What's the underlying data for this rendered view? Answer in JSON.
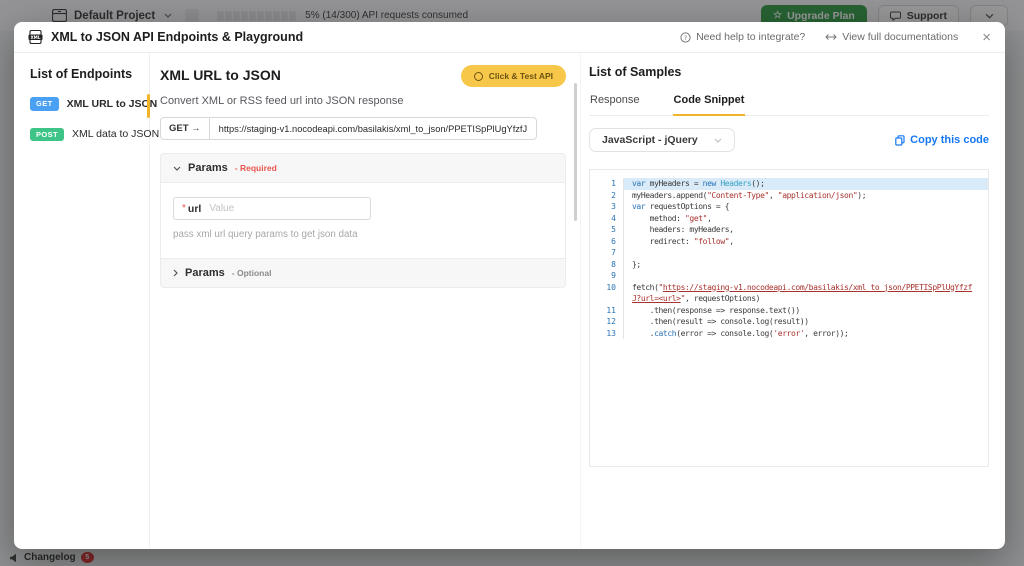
{
  "colors": {
    "accent": "#f0b429",
    "get": "#4aa0f2",
    "post": "#3fc487",
    "test_bg": "#f7c74a",
    "test_text": "#6d5414",
    "link": "#1778f2",
    "required": "#e6574d",
    "upgrade": "#2f9e44",
    "badge": "#e03131",
    "code_keyword": "#2973b7",
    "code_type": "#38a1c4",
    "code_string": "#a8322d",
    "num": "#2973b7",
    "hl": "#d9ebf8",
    "plain": "#3a3a3a"
  },
  "topbar": {
    "project": "Default Project",
    "segments": 10,
    "usage_text": "5% (14/300) API requests consumed",
    "upgrade_label": "Upgrade Plan",
    "upgrade_icon": "☆",
    "support_label": "Support"
  },
  "changelog": {
    "label": "Changelog",
    "count": "5"
  },
  "modal": {
    "title": "XML to JSON API Endpoints & Playground",
    "help_link": "Need help to integrate?",
    "docs_link": "View full documentations",
    "close_label": "×"
  },
  "sidebar": {
    "heading": "List of Endpoints",
    "items": [
      {
        "method": "GET",
        "label": "XML URL to JSON",
        "active": true
      },
      {
        "method": "POST",
        "label": "XML data to JSON",
        "active": false
      }
    ]
  },
  "endpoint": {
    "title": "XML URL to JSON",
    "test_button": "Click & Test API",
    "description": "Convert XML or RSS feed url into JSON response",
    "method_label": "GET →",
    "url": "https://staging-v1.nocodeapi.com/basilakis/xml_to_json/PPETISpPlUgYfzfJ",
    "params_required": {
      "title": "Params",
      "badge": "- Required",
      "field_label": "url",
      "asterisk": "*",
      "placeholder": "Value",
      "helper": "pass xml url query params to get json data"
    },
    "params_optional": {
      "title": "Params",
      "badge": "- Optional"
    }
  },
  "samples": {
    "heading": "List of Samples",
    "tabs": [
      "Response",
      "Code Snippet"
    ],
    "active_tab": "Code Snippet",
    "language": "JavaScript - jQuery",
    "copy_label": "Copy this code",
    "code": {
      "lines": [
        {
          "n": "1",
          "hl": true,
          "toks": [
            [
              "k",
              "var"
            ],
            [
              "p",
              " myHeaders = "
            ],
            [
              "k",
              "new"
            ],
            [
              "t",
              " Headers"
            ],
            [
              "p",
              "();"
            ]
          ]
        },
        {
          "n": "2",
          "toks": [
            [
              "p",
              "myHeaders.append("
            ],
            [
              "s",
              "\"Content-Type\""
            ],
            [
              "p",
              ", "
            ],
            [
              "s",
              "\"application/json\""
            ],
            [
              "p",
              ");"
            ]
          ]
        },
        {
          "n": "3",
          "toks": [
            [
              "k",
              "var"
            ],
            [
              "p",
              " requestOptions = {"
            ]
          ]
        },
        {
          "n": "4",
          "toks": [
            [
              "p",
              "    method: "
            ],
            [
              "s",
              "\"get\""
            ],
            [
              "p",
              ","
            ]
          ]
        },
        {
          "n": "5",
          "toks": [
            [
              "p",
              "    headers: myHeaders,"
            ]
          ]
        },
        {
          "n": "6",
          "toks": [
            [
              "p",
              "    redirect: "
            ],
            [
              "s",
              "\"follow\""
            ],
            [
              "p",
              ","
            ]
          ]
        },
        {
          "n": "7",
          "toks": []
        },
        {
          "n": "8",
          "toks": [
            [
              "p",
              "};"
            ]
          ]
        },
        {
          "n": "9",
          "toks": []
        },
        {
          "n": "10",
          "toks": [
            [
              "p",
              "fetch("
            ],
            [
              "s",
              "\""
            ],
            [
              "u",
              "https://staging-v1.nocodeapi.com/basilakis/xml_to_json/PPETISpPlUgYfzfJ?url=<url>"
            ],
            [
              "s",
              "\""
            ],
            [
              "p",
              ", requestOptions)"
            ]
          ]
        },
        {
          "n": "11",
          "toks": [
            [
              "p",
              "    .then(response => response.text())"
            ]
          ]
        },
        {
          "n": "12",
          "toks": [
            [
              "p",
              "    .then(result => console.log(result))"
            ]
          ]
        },
        {
          "n": "13",
          "toks": [
            [
              "p",
              "    ."
            ],
            [
              "k",
              "catch"
            ],
            [
              "p",
              "(error => console.log("
            ],
            [
              "s",
              "'error'"
            ],
            [
              "p",
              ", error));"
            ]
          ]
        }
      ]
    }
  }
}
